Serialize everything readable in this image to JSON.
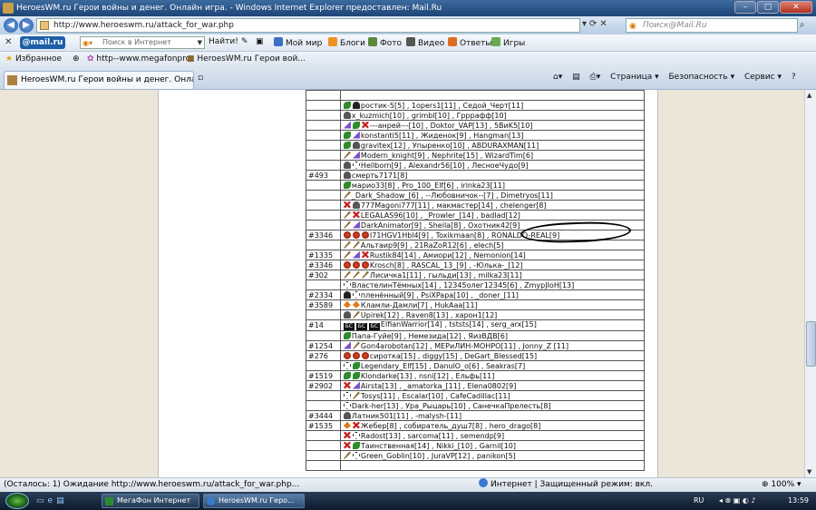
{
  "window": {
    "title": "HeroesWM.ru Герои войны и денег. Онлайн игра. - Windows Internet Explorer предоставлен: Mail.Ru",
    "buttons": [
      "–",
      "▢",
      "✕"
    ]
  },
  "address": {
    "url": "http://www.heroeswm.ru/attack_for_war.php",
    "search_placeholder": "Поиск@Mail.Ru"
  },
  "mailbar": {
    "logo_text": "@mail.ru",
    "search_placeholder": "Поиск в Интернет",
    "find_label": "Найти!",
    "items": [
      "Мой мир",
      "Блоги",
      "Фото",
      "Видео",
      "Ответы",
      "Игры"
    ]
  },
  "favorites": {
    "label": "Избранное",
    "links": [
      "http--www.megafonpro",
      "HeroesWM.ru Герои вой..."
    ]
  },
  "tab": {
    "title": "HeroesWM.ru Герои войны и денег. Онлайн игр..."
  },
  "tools": {
    "page": "Страница ▾",
    "safety": "Безопасность ▾",
    "service": "Сервис ▾",
    "help": "?"
  },
  "rows": [
    {
      "id": "",
      "icons": [],
      "text": ""
    },
    {
      "id": "",
      "icons": [
        "lf",
        "sk"
      ],
      "text": "ростик-5[5] , 1opers1[11] , Седой_Черт[11]"
    },
    {
      "id": "",
      "icons": [
        "hm"
      ],
      "text": "x_kuzmich[10] , grimbl[10] , Грррафф[10]"
    },
    {
      "id": "",
      "icons": [
        "tri",
        "lf",
        "rx"
      ],
      "text": "---aнрей---[10] , Doktor_VAP[13] , 5BиK5[10]"
    },
    {
      "id": "",
      "icons": [
        "lf",
        "tri"
      ],
      "text": "konstanti5[11] , Жиденок[9] , Hangman[13]"
    },
    {
      "id": "",
      "icons": [
        "lf",
        "hm"
      ],
      "text": "gravitex[12] , Упыренко[10] , ABDURAXMAN[11]"
    },
    {
      "id": "",
      "icons": [
        "sw",
        "tri"
      ],
      "text": "Modern_knight[9] , Nephrite[15] , WizardTim[6]"
    },
    {
      "id": "",
      "icons": [
        "hm",
        "cr"
      ],
      "text": "Hellborn[9] , Alexandr56[10] , ЛесноеЧудо[9]"
    },
    {
      "id": "#493",
      "icons": [
        "hm"
      ],
      "text": "смерть7171[8]"
    },
    {
      "id": "",
      "icons": [
        "lf"
      ],
      "text": "марио33[8] , Pro_100_Elf[6] , irinka23[11]"
    },
    {
      "id": "",
      "icons": [
        "sw"
      ],
      "text": "_Dark_Shadow_[6] , --Любовничок--[7] , Dimetryos[11]"
    },
    {
      "id": "",
      "icons": [
        "rx",
        "hm"
      ],
      "text": "777Magoni777[11] , макмастер[14] , chelenger[8]"
    },
    {
      "id": "",
      "icons": [
        "sw",
        "rx"
      ],
      "text": "LEGALAS96[10] , _Prowler_[14] , badlad[12]"
    },
    {
      "id": "",
      "icons": [
        "sw",
        "tri"
      ],
      "text": "DarkAnimator[9] , Sheila[8] , Охотник42[9]"
    },
    {
      "id": "#3346",
      "icons": [
        "ball",
        "ball",
        "ball"
      ],
      "text": "I71HGV1Hbl4[9] , Toxikmaan[8] , RONALDO-REAL[9]"
    },
    {
      "id": "",
      "icons": [
        "sw",
        "sw"
      ],
      "text": "Альтаир9[9] , 21RaZoR12[6] , elech[5]"
    },
    {
      "id": "#1335",
      "icons": [
        "sw",
        "tri",
        "rx"
      ],
      "text": "Rustik84[14] , Амиори[12] , Nemonion[14]"
    },
    {
      "id": "#3346",
      "icons": [
        "ball",
        "ball",
        "ball"
      ],
      "text": "Krosch[8] , RASCAL_13_[9] , -Юлька-_[12]"
    },
    {
      "id": "#302",
      "icons": [
        "sw",
        "sw",
        "sw"
      ],
      "text": "Лисичка1[11] , гыльди[13] , milka23[11]"
    },
    {
      "id": "",
      "icons": [
        "cr"
      ],
      "text": "ВластелинТёмных[14] , 12345олег12345[6] , ZmypJIoH[13]"
    },
    {
      "id": "#2334",
      "icons": [
        "sk",
        "cr"
      ],
      "text": "пленённый[9] , PsiXPapa[10] , _doner_[11]"
    },
    {
      "id": "#3589",
      "icons": [
        "fl",
        "fl"
      ],
      "text": "Кламли-Дамли[7] , HukAaa[11]"
    },
    {
      "id": "",
      "icons": [
        "hm",
        "sw"
      ],
      "text": "Upirek[12] , Raven8[13] , харон1[12]"
    },
    {
      "id": "#14",
      "icons": [
        "bs",
        "bs",
        "bs"
      ],
      "text": "ElfianWarrior[14] , tststs[14] , serg_arx[15]"
    },
    {
      "id": "",
      "icons": [
        "lf"
      ],
      "text": "Папа-Гуйе[9] , Немезида[12] , ЯизВДВ[6]"
    },
    {
      "id": "#1254",
      "icons": [
        "tri",
        "sw"
      ],
      "text": "Gon4arobotan[12] , МЕРиЛИН-МОНРО[11] , Jonny_Z [11]"
    },
    {
      "id": "#276",
      "icons": [
        "ball",
        "ball",
        "ball"
      ],
      "text": "сиротка[15] , diggy[15] , DeGart_Blessed[15]"
    },
    {
      "id": "",
      "icons": [
        "cr",
        "lf"
      ],
      "text": "Legendary_Elf[15] , DanulO_o[6] , Seakras[7]"
    },
    {
      "id": "#1519",
      "icons": [
        "lf",
        "lf"
      ],
      "text": "Klondarke[13] , nsni[12] , Ельфь[11]"
    },
    {
      "id": "#2902",
      "icons": [
        "rx",
        "tri"
      ],
      "text": "Airsta[13] , _amatorka_[11] , Elena0802[9]"
    },
    {
      "id": "",
      "icons": [
        "cr",
        "sw"
      ],
      "text": "Tosys[11] , Escalar[10] , CafeCadillac[11]"
    },
    {
      "id": "",
      "icons": [
        "cr"
      ],
      "text": "Dark-her[13] , Ура_Рыцарь[10] , СанечкаПрелесть[8]"
    },
    {
      "id": "#3444",
      "icons": [
        "hm"
      ],
      "text": "Латник501[11] , -malysh-[11]"
    },
    {
      "id": "#1535",
      "icons": [
        "fl",
        "rx"
      ],
      "text": "Жебер[8] , собиратель_душ7[8] , hero_drago[8]"
    },
    {
      "id": "",
      "icons": [
        "rx",
        "cr"
      ],
      "text": "Radost[13] , sarcoma[11] , semendp[9]"
    },
    {
      "id": "",
      "icons": [
        "rx",
        "lf"
      ],
      "text": "Таинственная[14] , Nikki_[10] , Garnil[10]"
    },
    {
      "id": "",
      "icons": [
        "sw",
        "cr"
      ],
      "text": "Green_Goblin[10] , JuraVP[12] , panikon[5]"
    },
    {
      "id": "",
      "icons": [],
      "text": ""
    }
  ],
  "status": {
    "text": "(Осталось: 1) Ожидание http://www.heroeswm.ru/attack_for_war.php...",
    "zone": "Интернет | Защищенный режим: вкл.",
    "zoom": "100%"
  },
  "taskbar": {
    "tasks": [
      "МегаФон Интернет",
      "HeroesWM.ru Геро..."
    ],
    "lang": "RU",
    "time": "13:59"
  }
}
